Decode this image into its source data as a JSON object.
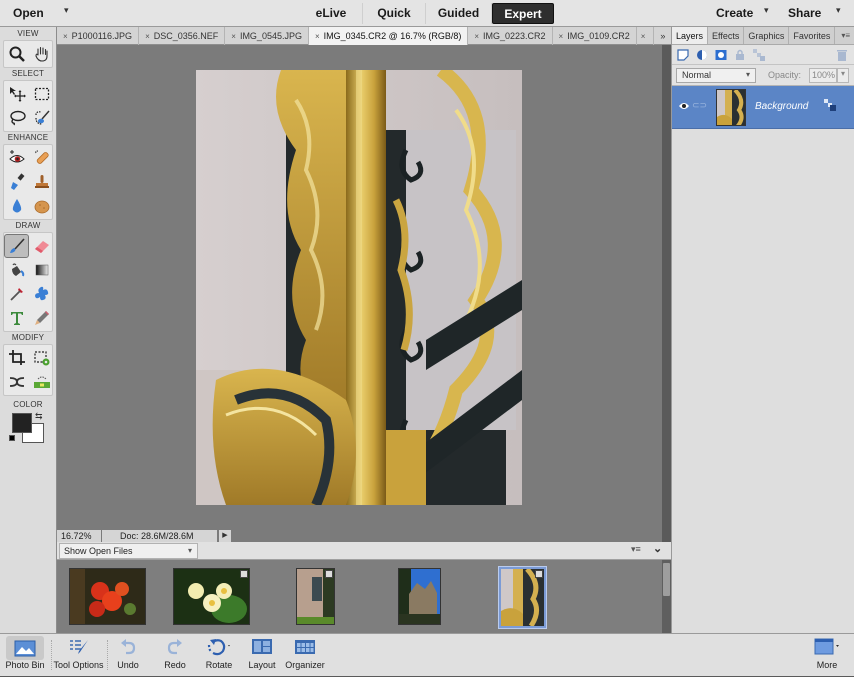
{
  "topbar": {
    "open_label": "Open",
    "open_caret": "▾",
    "modes": [
      "eLive",
      "Quick",
      "Guided",
      "Expert"
    ],
    "active_mode": "Expert",
    "create_label": "Create",
    "share_label": "Share",
    "caret": "▾"
  },
  "toolbox": {
    "sections": {
      "view": "VIEW",
      "select": "SELECT",
      "enhance": "ENHANCE",
      "draw": "DRAW",
      "modify": "MODIFY",
      "color": "COLOR"
    },
    "tools": {
      "view": [
        "zoom-tool",
        "hand-tool"
      ],
      "select": [
        "move-tool",
        "marquee-tool",
        "lasso-tool",
        "quick-selection-tool"
      ],
      "enhance": [
        "red-eye-tool",
        "healing-brush-tool",
        "smart-brush-tool",
        "clone-stamp-tool",
        "blur-tool",
        "sponge-tool"
      ],
      "draw": [
        "brush-tool",
        "eraser-tool",
        "paint-bucket-tool",
        "gradient-tool",
        "eyedropper-tool",
        "custom-shape-tool",
        "type-tool",
        "pencil-tool"
      ],
      "modify": [
        "crop-tool",
        "recompose-tool",
        "content-aware-move-tool",
        "straighten-tool"
      ]
    },
    "selected_tool": "brush-tool",
    "foreground_color": "#222222",
    "background_color": "#ffffff"
  },
  "tabs": [
    {
      "label": "P1000116.JPG",
      "active": false
    },
    {
      "label": "DSC_0356.NEF",
      "active": false
    },
    {
      "label": "IMG_0545.JPG",
      "active": false
    },
    {
      "label": "IMG_0345.CR2 @ 16.7% (RGB/8)",
      "active": true
    },
    {
      "label": "IMG_0223.CR2",
      "active": false
    },
    {
      "label": "IMG_0109.CR2",
      "active": false
    }
  ],
  "tab_close_glyph": "×",
  "tab_overflow": "»",
  "status": {
    "zoom": "16.72%",
    "doc": "Doc: 28.6M/28.6M",
    "arrow": "▶"
  },
  "bin": {
    "filter_label": "Show Open Files",
    "caret": "▾",
    "menu_glyph": "▾≡",
    "collapse_glyph": "⌄",
    "thumbnails": [
      {
        "name": "red-flowers",
        "selected": false,
        "badge": false
      },
      {
        "name": "frangipani-flowers",
        "selected": false,
        "badge": true
      },
      {
        "name": "window-wall",
        "selected": false,
        "badge": true
      },
      {
        "name": "chateau",
        "selected": false,
        "badge": false
      },
      {
        "name": "gilded-railing",
        "selected": true,
        "badge": true
      }
    ]
  },
  "panel": {
    "tabs": [
      "Layers",
      "Effects",
      "Graphics",
      "Favorites"
    ],
    "active_tab": "Layers",
    "menu_glyph": "▾≡",
    "blend_mode": "Normal",
    "opacity_label": "Opacity:",
    "opacity_value": "100%",
    "layers": [
      {
        "name": "Background",
        "visible": true,
        "locked": true
      }
    ]
  },
  "bottombar": {
    "buttons": [
      {
        "label": "Photo Bin",
        "icon": "photo-bin-icon",
        "active": true
      },
      {
        "label": "Tool Options",
        "icon": "tool-options-icon",
        "active": false
      },
      {
        "label": "Undo",
        "icon": "undo-icon",
        "active": false
      },
      {
        "label": "Redo",
        "icon": "redo-icon",
        "active": false
      },
      {
        "label": "Rotate",
        "icon": "rotate-icon",
        "active": false
      },
      {
        "label": "Layout",
        "icon": "layout-icon",
        "active": false
      },
      {
        "label": "Organizer",
        "icon": "organizer-icon",
        "active": false
      }
    ],
    "more_label": "More"
  },
  "colors": {
    "accent": "#5b85c6",
    "active_mode_bg": "#2e2e2e"
  }
}
